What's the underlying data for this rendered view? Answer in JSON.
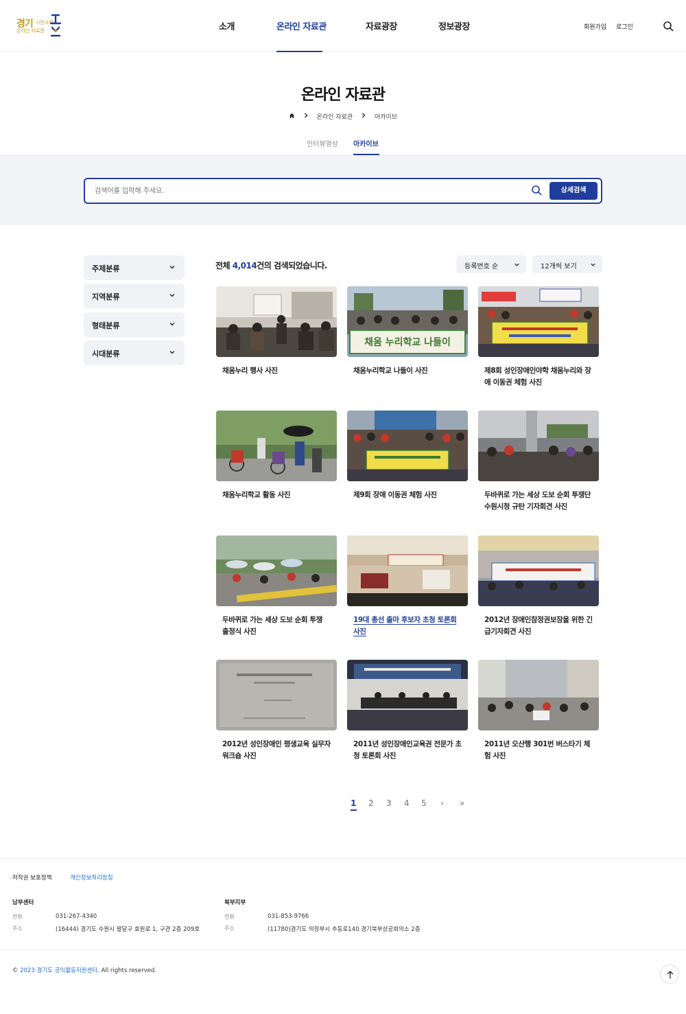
{
  "header": {
    "logo_main": "경기",
    "logo_sub1": "시민사회",
    "logo_sub2": "온라인 자료관",
    "nav": [
      "소개",
      "온라인 자료관",
      "자료광장",
      "정보광장"
    ],
    "active_nav": "온라인 자료관",
    "signup": "회원가입",
    "login": "로그인",
    "search_icon": "search-icon"
  },
  "page": {
    "title": "온라인 자료관",
    "breadcrumb": [
      "home-icon",
      "온라인 자료관",
      "아카이브"
    ],
    "breadcrumb_1": "온라인 자료관",
    "breadcrumb_2": "아카이브",
    "tabs": [
      "인터뷰영상",
      "아카이브"
    ],
    "active_tab": "아카이브"
  },
  "search": {
    "placeholder": "검색어를 입력해 주세요.",
    "advanced_label": "상세검색"
  },
  "filters": [
    "주제분류",
    "지역분류",
    "형태분류",
    "시대분류"
  ],
  "results": {
    "prefix": "전체 ",
    "count": "4,014",
    "suffix": "건의 검색되었습니다.",
    "sort_label": "등록번호 순",
    "view_label": "12개씩 보기"
  },
  "items": [
    {
      "caption": "채움누리 행사 사진"
    },
    {
      "caption": "채움누리학교 나들이 사진",
      "banner_text": "채움 누리학교 나들이"
    },
    {
      "caption": "제8회 성인장애인야학 채움누리와 장애 이동권 체험 사진"
    },
    {
      "caption": "채움누리학교 활동 사진"
    },
    {
      "caption": "제9회 장애 이동권 체험 사진"
    },
    {
      "caption": "두바퀴로 가는 세상 도보 순회 투쟁단 수원시청 규탄 기자회견 사진"
    },
    {
      "caption": "두바퀴로 가는 세상 도보 순회 투쟁 출정식 사진"
    },
    {
      "caption": "19대 총선 출마 후보자 초청 토론회 사진"
    },
    {
      "caption": "2012년 장애인참정권보장을 위한 긴급기자회견 사진"
    },
    {
      "caption": "2012년 성인장애인 평생교육 실무자 워크숍 사진"
    },
    {
      "caption": "2011년 성인장애인교육권 전문가 초청 토론회 사진"
    },
    {
      "caption": "2011년 오산행 301번 버스타기 체험 사진"
    }
  ],
  "pagination": {
    "pages": [
      "1",
      "2",
      "3",
      "4",
      "5"
    ],
    "current": "1",
    "next": "›",
    "last": "»"
  },
  "footer": {
    "links": [
      "저작권 보호정책",
      "개인정보처리방침"
    ],
    "south": {
      "name": "남부센터",
      "phone_label": "전화",
      "phone": "031-267-4340",
      "addr_label": "주소",
      "address": "(16444) 경기도 수원시 팔달구 효원로 1, 구관 2층 209호"
    },
    "north": {
      "name": "북부지부",
      "phone_label": "전화",
      "phone": "031-853-9766",
      "addr_label": "주소",
      "address": "(11780)경기도 의정부시 추동로140 경기북부상공회의소 2층"
    },
    "copyright_symbol": "©",
    "copyright_org": "2023 경기도 공익활동지원센터.",
    "copyright_rest": "All rights reserved."
  },
  "colors": {
    "accent": "#1f3d9c",
    "logo": "#c59a22",
    "band": "#f3f4f8"
  }
}
